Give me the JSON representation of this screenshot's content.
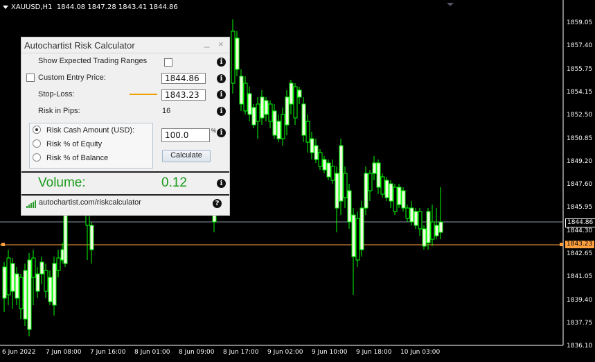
{
  "chart_header": {
    "symbol": "XAUUSD,H1",
    "ohlc": "1844.08 1847.28 1843.41 1844.86"
  },
  "y_axis": [
    "1859.05",
    "1857.40",
    "1855.75",
    "1854.15",
    "1852.50",
    "1850.85",
    "1849.20",
    "1847.60",
    "1845.95",
    "1844.30",
    "1842.65",
    "1841.05",
    "1839.40",
    "1837.75",
    "1836.10"
  ],
  "x_axis": [
    "6 Jun 2022",
    "7 Jun 08:00",
    "7 Jun 16:00",
    "8 Jun 01:00",
    "8 Jun 09:00",
    "8 Jun 17:00",
    "9 Jun 02:00",
    "9 Jun 10:00",
    "9 Jun 18:00",
    "10 Jun 03:00"
  ],
  "price_tags": {
    "current": "1844.86",
    "stop_loss": "1843.23"
  },
  "colors": {
    "background": "#000000",
    "candle": "#00ff00",
    "bull_body": "#f0f8e0",
    "stop_line": "#ffa040",
    "volume_green": "#1a9a1a"
  },
  "panel": {
    "title": "Autochartist Risk Calculator",
    "minimize_icon": "_",
    "close_icon": "×",
    "show_ranges_label": "Show Expected Trading Ranges",
    "custom_entry_label": "Custom Entry Price:",
    "entry_price": "1844.86",
    "stop_loss_label": "Stop-Loss:",
    "stop_loss_value": "1843.23",
    "risk_pips_label": "Risk in Pips:",
    "risk_pips_value": "16",
    "options": [
      "Risk Cash Amount (USD):",
      "Risk % of Equity",
      "Risk % of Balance"
    ],
    "selected_option": 0,
    "risk_amount": "100.0",
    "percent_sign": "%",
    "calculate_label": "Calculate",
    "volume_label": "Volume:",
    "volume_value": "0.12",
    "link_text": "autochartist.com/riskcalculator",
    "info_glyph": "i",
    "help_glyph": "?"
  }
}
